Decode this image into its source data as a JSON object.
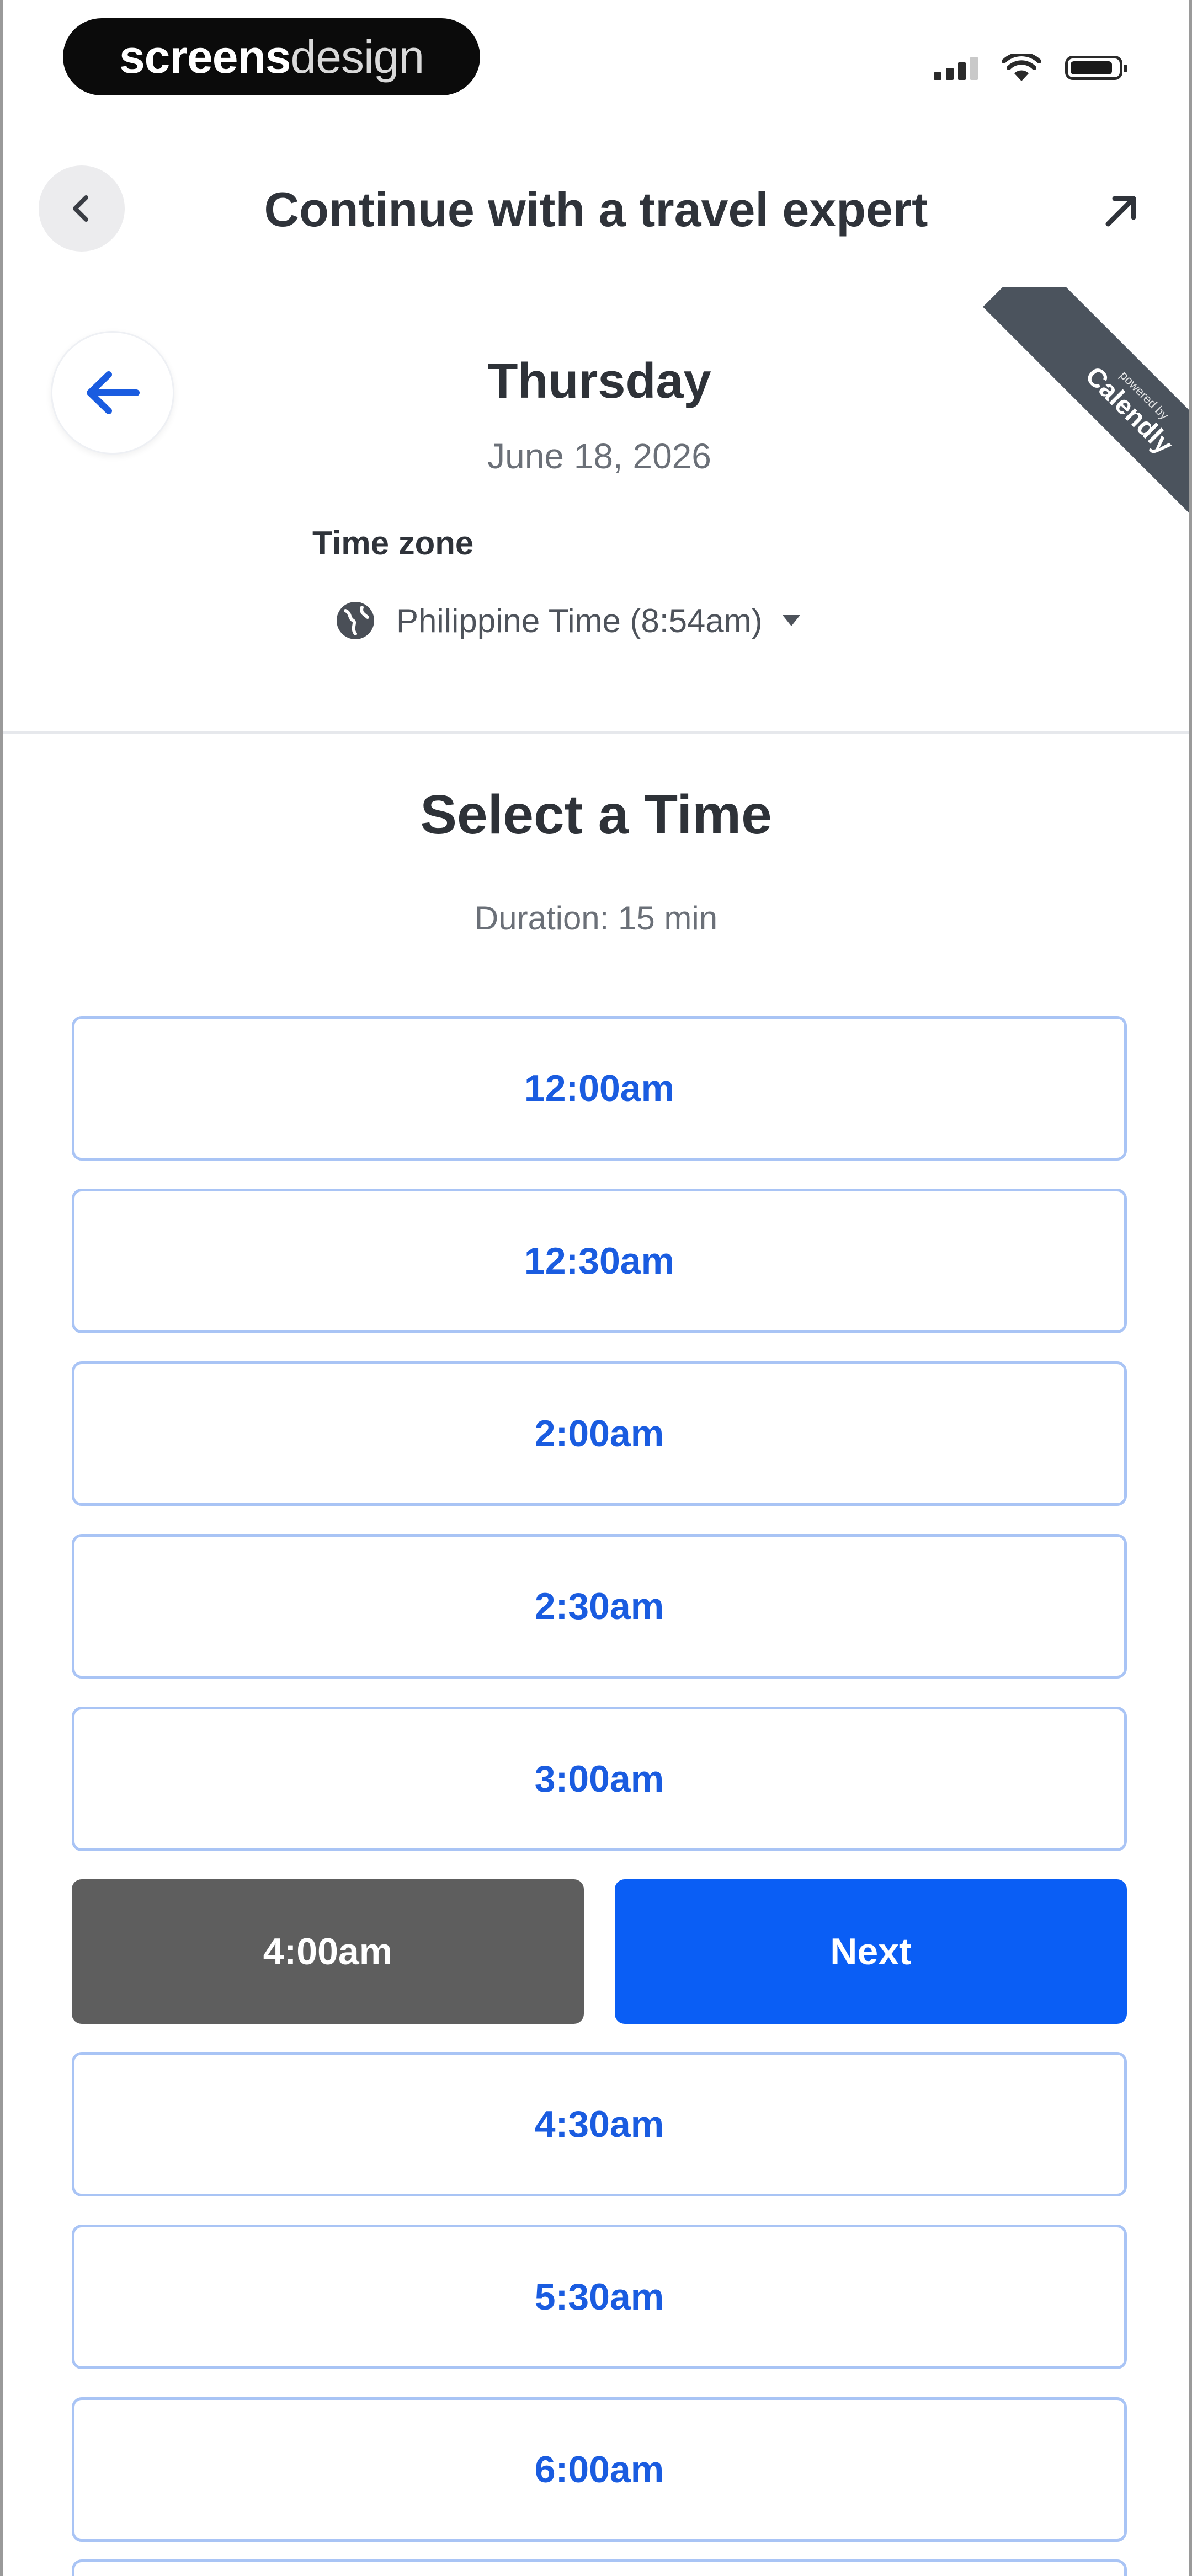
{
  "status_bar": {
    "brand_part1": "screens",
    "brand_part2": "design"
  },
  "header": {
    "title": "Continue with a travel expert"
  },
  "ribbon": {
    "small_text": "powered by",
    "brand": "Calendly"
  },
  "date": {
    "day": "Thursday",
    "full_date": "June 18, 2026"
  },
  "timezone": {
    "label": "Time zone",
    "value": "Philippine Time (8:54am)"
  },
  "time_select": {
    "title": "Select a Time",
    "duration": "Duration: 15 min",
    "slots_before": [
      "12:00am",
      "12:30am",
      "2:00am",
      "2:30am",
      "3:00am"
    ],
    "selected_slot": "4:00am",
    "next_label": "Next",
    "slots_after": [
      "4:30am",
      "5:30am",
      "6:00am"
    ]
  },
  "colors": {
    "accent": "#0a5ef5",
    "slot_text": "#1a5ce0",
    "slot_border": "#a9c4f5",
    "selected_bg": "#5e5e5e",
    "ribbon_bg": "#4b535d"
  }
}
